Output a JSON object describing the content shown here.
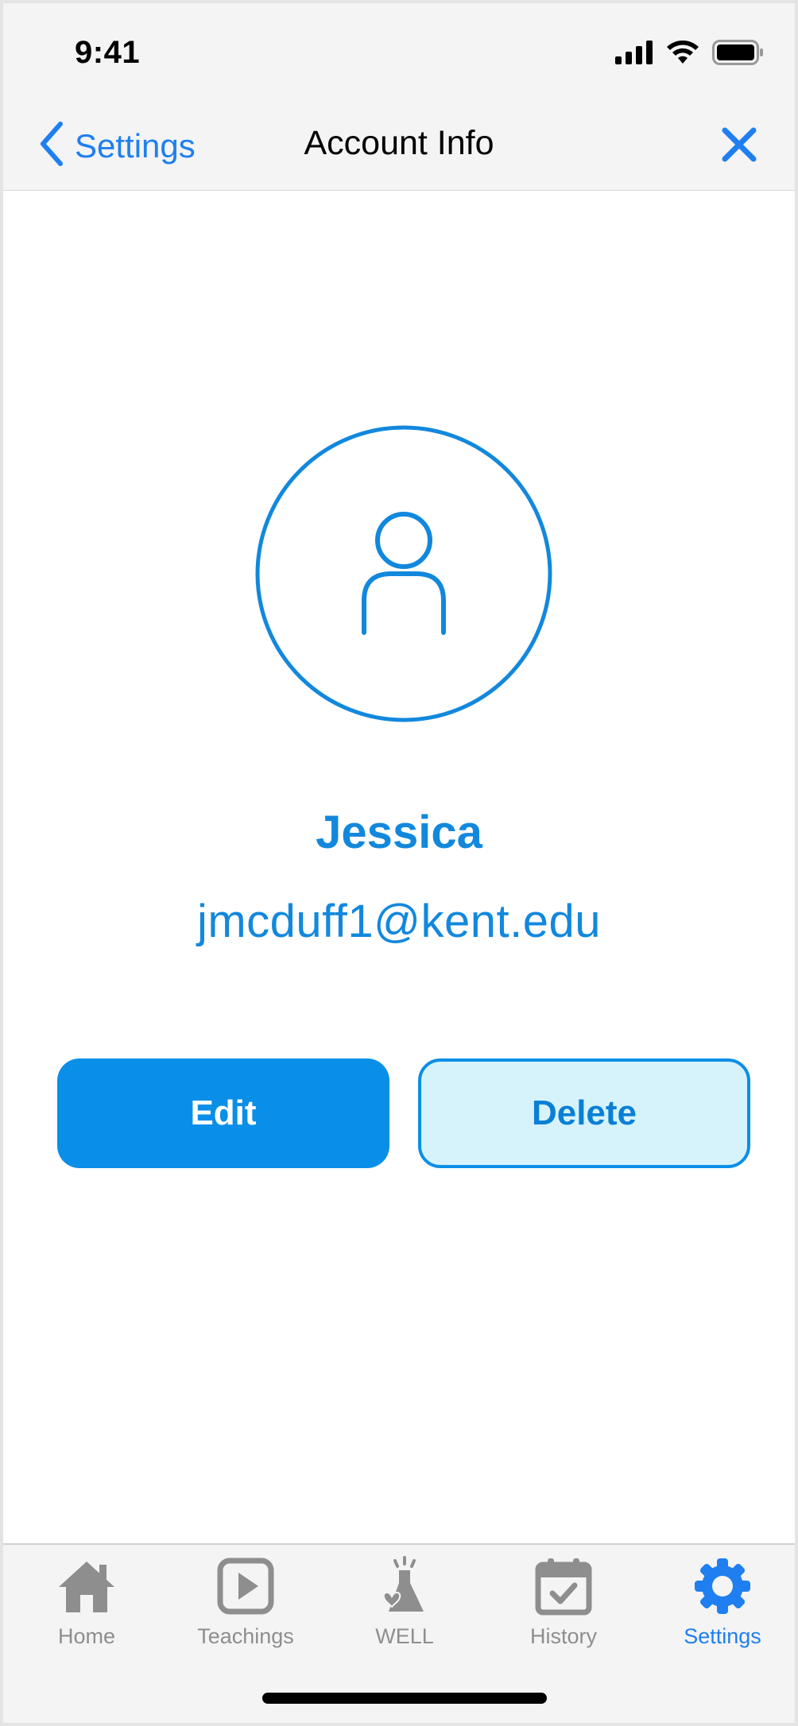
{
  "status_bar": {
    "time": "9:41",
    "icons": [
      "cellular-signal-icon",
      "wifi-icon",
      "battery-icon"
    ]
  },
  "nav": {
    "back_label": "Settings",
    "title": "Account Info",
    "close_icon": "close-icon"
  },
  "profile": {
    "avatar_icon": "user-icon",
    "name": "Jessica",
    "email": "jmcduff1@kent.edu"
  },
  "actions": {
    "edit_label": "Edit",
    "delete_label": "Delete"
  },
  "tab_bar": {
    "items": [
      {
        "label": "Home",
        "icon": "home-icon"
      },
      {
        "label": "Teachings",
        "icon": "play-icon"
      },
      {
        "label": "WELL",
        "icon": "well-flask-icon"
      },
      {
        "label": "History",
        "icon": "calendar-check-icon"
      },
      {
        "label": "Settings",
        "icon": "gear-icon",
        "active": true
      }
    ]
  },
  "colors": {
    "accent": "#1f7ff0",
    "brand_blue": "#0a8fe8",
    "text_blue": "#1288dd",
    "delete_bg": "#d6f3fb",
    "inactive_gray": "#8e8e8e",
    "bar_bg": "#f4f4f4"
  }
}
